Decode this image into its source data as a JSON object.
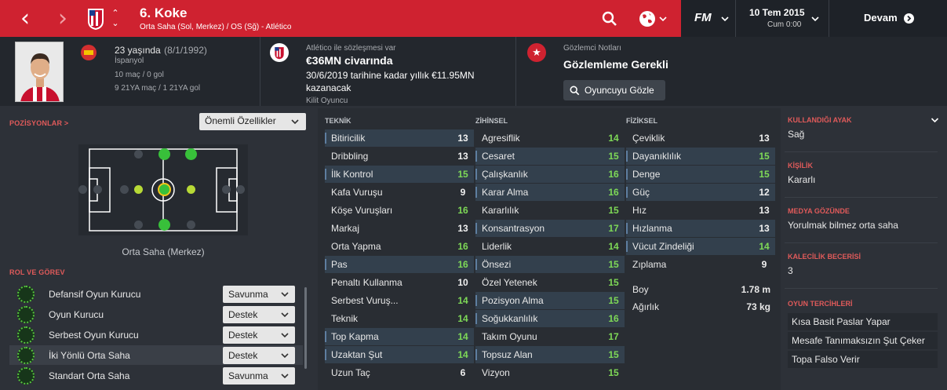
{
  "header": {
    "title": "6. Koke",
    "subtitle": "Orta Saha (Sol, Merkez) / OS (Sğ) - Atlético",
    "date": "10 Tem 2015",
    "time": "Cum 0:00",
    "continue_label": "Devam",
    "fm_logo": "FM"
  },
  "profile": {
    "age": "23 yaşında",
    "dob": "(8/1/1992)",
    "nation": "İspanyol",
    "intl": "10 maç / 0 gol",
    "u21": "9 21YA maç / 1 21YA gol",
    "contract_label": "Atlético ile sözleşmesi var",
    "value": "€36MN civarında",
    "wage_line1": "30/6/2019 tarihine kadar yıllık €11.95MN",
    "wage_line2": "kazanacak",
    "status": "Kilit Oyuncu",
    "scout_label": "Gözlemci Notları",
    "scout_value": "Gözlemleme Gerekli",
    "watch_button": "Oyuncuyu Gözle"
  },
  "positions": {
    "title": "POZİSYONLAR >",
    "filter": "Önemli Özellikler",
    "caption": "Orta Saha (Merkez)"
  },
  "roles": {
    "title": "ROL VE GÖREV",
    "items": [
      {
        "name": "Defansif Oyun Kurucu",
        "duty": "Savunma"
      },
      {
        "name": "Oyun Kurucu",
        "duty": "Destek"
      },
      {
        "name": "Serbest Oyun Kurucu",
        "duty": "Destek"
      },
      {
        "name": "İki Yönlü Orta Saha",
        "duty": "Destek"
      },
      {
        "name": "Standart Orta Saha",
        "duty": "Savunma"
      }
    ]
  },
  "attributes": {
    "technical_title": "TEKNİK",
    "mental_title": "ZİHİNSEL",
    "physical_title": "FİZİKSEL",
    "technical": [
      {
        "name": "Bitiricilik",
        "value": "13",
        "hl": true
      },
      {
        "name": "Dribbling",
        "value": "13",
        "hl": false
      },
      {
        "name": "İlk Kontrol",
        "value": "15",
        "hl": true
      },
      {
        "name": "Kafa Vuruşu",
        "value": "9",
        "hl": false
      },
      {
        "name": "Köşe Vuruşları",
        "value": "16",
        "hl": false
      },
      {
        "name": "Markaj",
        "value": "13",
        "hl": false
      },
      {
        "name": "Orta Yapma",
        "value": "16",
        "hl": false
      },
      {
        "name": "Pas",
        "value": "16",
        "hl": true
      },
      {
        "name": "Penaltı Kullanma",
        "value": "10",
        "hl": false
      },
      {
        "name": "Serbest Vuruş...",
        "value": "14",
        "hl": false
      },
      {
        "name": "Teknik",
        "value": "14",
        "hl": false
      },
      {
        "name": "Top Kapma",
        "value": "14",
        "hl": true
      },
      {
        "name": "Uzaktan Şut",
        "value": "14",
        "hl": true
      },
      {
        "name": "Uzun Taç",
        "value": "6",
        "hl": false
      }
    ],
    "mental": [
      {
        "name": "Agresiflik",
        "value": "14",
        "hl": false
      },
      {
        "name": "Cesaret",
        "value": "15",
        "hl": true
      },
      {
        "name": "Çalışkanlık",
        "value": "16",
        "hl": true
      },
      {
        "name": "Karar Alma",
        "value": "16",
        "hl": true
      },
      {
        "name": "Kararlılık",
        "value": "15",
        "hl": false
      },
      {
        "name": "Konsantrasyon",
        "value": "17",
        "hl": true
      },
      {
        "name": "Liderlik",
        "value": "14",
        "hl": false
      },
      {
        "name": "Önsezi",
        "value": "15",
        "hl": true
      },
      {
        "name": "Özel Yetenek",
        "value": "15",
        "hl": false
      },
      {
        "name": "Pozisyon Alma",
        "value": "15",
        "hl": true
      },
      {
        "name": "Soğukkanlılık",
        "value": "16",
        "hl": true
      },
      {
        "name": "Takım Oyunu",
        "value": "17",
        "hl": false
      },
      {
        "name": "Topsuz Alan",
        "value": "15",
        "hl": true
      },
      {
        "name": "Vizyon",
        "value": "15",
        "hl": false
      }
    ],
    "physical": [
      {
        "name": "Çeviklik",
        "value": "13",
        "hl": false
      },
      {
        "name": "Dayanıklılık",
        "value": "15",
        "hl": true
      },
      {
        "name": "Denge",
        "value": "15",
        "hl": true
      },
      {
        "name": "Güç",
        "value": "12",
        "hl": true
      },
      {
        "name": "Hız",
        "value": "13",
        "hl": false
      },
      {
        "name": "Hızlanma",
        "value": "13",
        "hl": true
      },
      {
        "name": "Vücut Zindeliği",
        "value": "14",
        "hl": true
      },
      {
        "name": "Zıplama",
        "value": "9",
        "hl": false
      }
    ],
    "height_label": "Boy",
    "height": "1.78 m",
    "weight_label": "Ağırlık",
    "weight": "73 kg"
  },
  "side": {
    "foot_title": "KULLANDIĞI AYAK",
    "foot": "Sağ",
    "personality_title": "KİŞİLİK",
    "personality": "Kararlı",
    "media_title": "MEDYA GÖZÜNDE",
    "media": "Yorulmak bilmez orta saha",
    "gk_title": "KALECİLİK BECERİSİ",
    "gk": "3",
    "prefs_title": "OYUN TERCİHLERİ",
    "prefs": [
      "Kısa Basit Paslar Yapar",
      "Mesafe Tanımaksızın Şut Çeker",
      "Topa Falso Verir"
    ]
  },
  "colors": {
    "accent": "#cf2230",
    "good": "#7ed957",
    "highlight_row": "#33404d"
  }
}
